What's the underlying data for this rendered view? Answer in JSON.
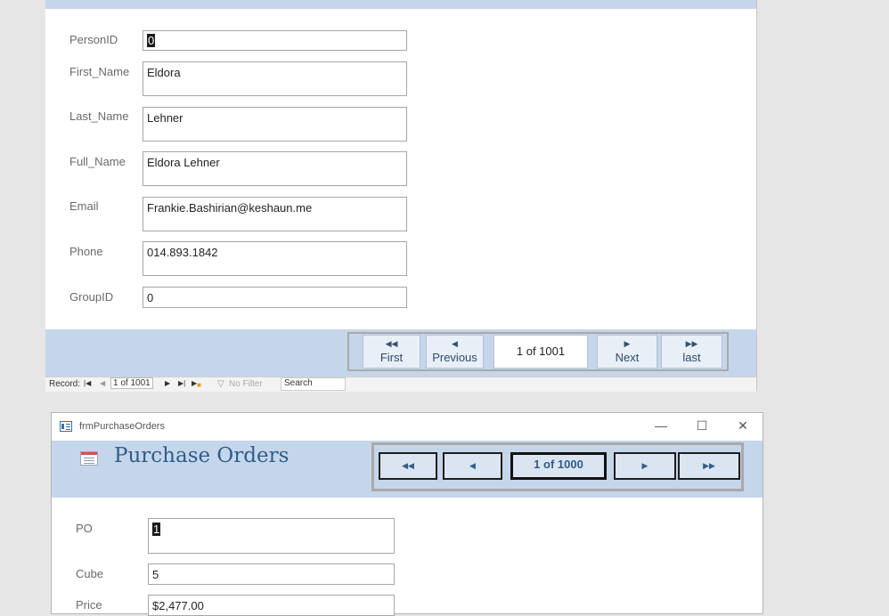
{
  "people_form": {
    "fields": [
      {
        "label": "PersonID",
        "value": "0"
      },
      {
        "label": "First_Name",
        "value": "Eldora"
      },
      {
        "label": "Last_Name",
        "value": "Lehner"
      },
      {
        "label": "Full_Name",
        "value": "Eldora Lehner"
      },
      {
        "label": "Email",
        "value": "Frankie.Bashirian@keshaun.me"
      },
      {
        "label": "Phone",
        "value": "014.893.1842"
      },
      {
        "label": "GroupID",
        "value": "0"
      }
    ],
    "nav": {
      "first": "First",
      "previous": "Previous",
      "counter": "1 of 1001",
      "next": "Next",
      "last": "last"
    },
    "record_bar": {
      "record_label": "Record:",
      "position": "1 of 1001",
      "filter": "No Filter",
      "search": "Search"
    }
  },
  "po_window": {
    "title": "frmPurchaseOrders",
    "form_title": "Purchase Orders",
    "counter": "1 of 1000",
    "fields": [
      {
        "label": "PO",
        "value": "1"
      },
      {
        "label": "Cube",
        "value": "5"
      },
      {
        "label": "Price",
        "value": "$2,477.00"
      }
    ]
  },
  "icons": [
    "first-record-icon",
    "previous-record-icon",
    "next-record-icon",
    "last-record-icon",
    "new-record-icon",
    "filter-icon",
    "form-icon",
    "minimize-icon",
    "maximize-icon",
    "close-icon"
  ]
}
